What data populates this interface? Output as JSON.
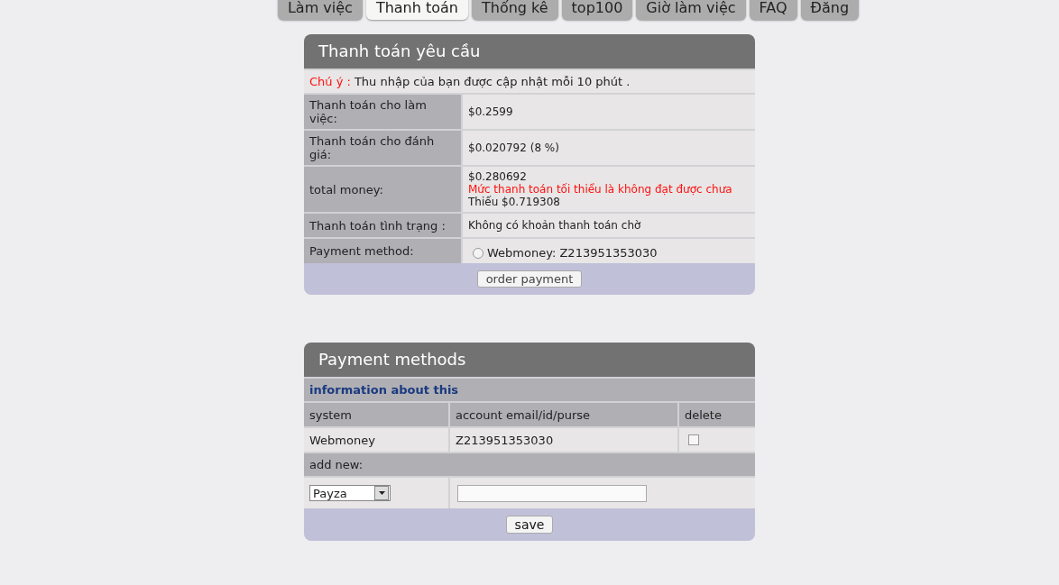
{
  "tabs": [
    {
      "label": "Làm việc",
      "selected": false
    },
    {
      "label": "Thanh toán",
      "selected": true
    },
    {
      "label": "Thống kê",
      "selected": false
    },
    {
      "label": "top100",
      "selected": false
    },
    {
      "label": "Giờ làm việc",
      "selected": false
    },
    {
      "label": "FAQ",
      "selected": false
    },
    {
      "label": "Đăng",
      "selected": false
    }
  ],
  "payment_request": {
    "title": "Thanh toán yêu cầu",
    "notice": {
      "label": "Chú ý :",
      "text": "Thu nhập của bạn được cập nhật mỗi 10 phút ."
    },
    "rows": [
      {
        "label": "Thanh toán cho làm việc:",
        "kind": "text",
        "lines": [
          {
            "text": "$0.2599",
            "warning": false
          }
        ]
      },
      {
        "label": "Thanh toán cho đánh giá:",
        "kind": "text",
        "lines": [
          {
            "text": "$0.020792 (8 %)",
            "warning": false
          }
        ]
      },
      {
        "label": "total money:",
        "kind": "text",
        "lines": [
          {
            "text": "$0.280692",
            "warning": false
          },
          {
            "text": "Mức thanh toán tối thiểu là không đạt được chưa",
            "warning": true
          },
          {
            "text": "Thiếu $0.719308",
            "warning": false
          }
        ]
      },
      {
        "label": "Thanh toán tình trạng :",
        "kind": "text",
        "lines": [
          {
            "text": "Không có khoản thanh toán chờ",
            "warning": false
          }
        ]
      },
      {
        "label": "Payment method:",
        "kind": "radio",
        "option": {
          "text": "Webmoney: Z213951353030",
          "selected": false
        }
      }
    ],
    "button": "order payment"
  },
  "payment_methods": {
    "title": "Payment methods",
    "info_link": "information about this",
    "columns": [
      "system",
      "account email/id/purse",
      "delete"
    ],
    "rows": [
      {
        "system": "Webmoney",
        "account": "Z213951353030",
        "delete_checked": false
      }
    ],
    "add_new": {
      "label": "add new:",
      "system": "Payza"
    },
    "button": "save"
  }
}
